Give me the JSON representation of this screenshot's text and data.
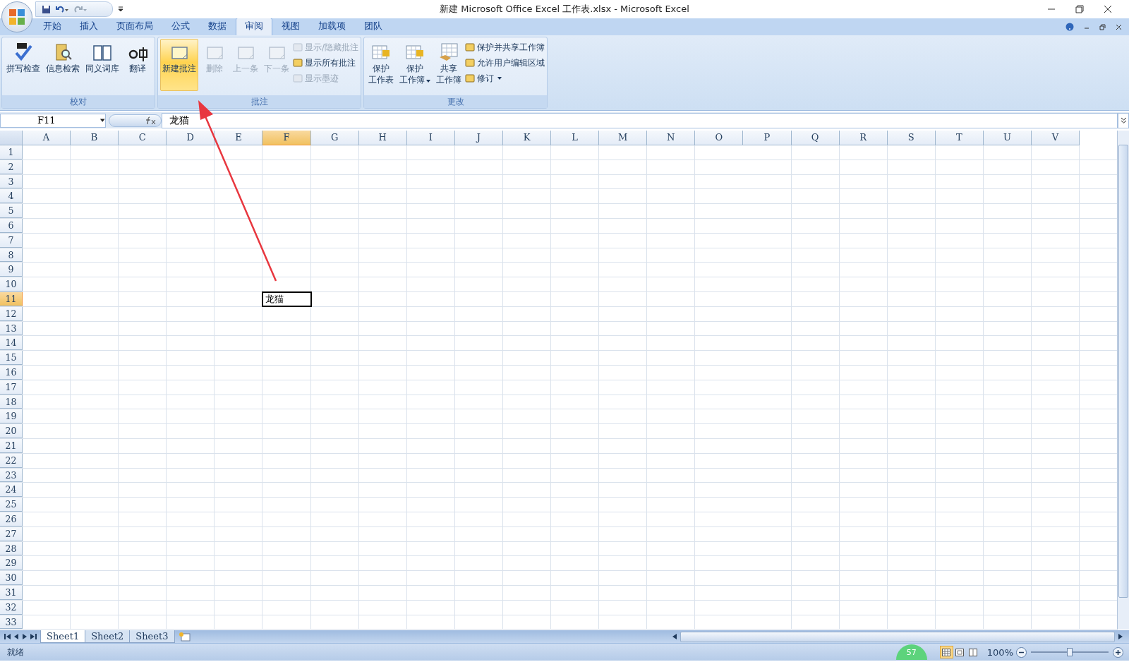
{
  "window": {
    "title": "新建 Microsoft Office Excel 工作表.xlsx - Microsoft Excel"
  },
  "tabs": [
    {
      "label": "开始",
      "selected": false
    },
    {
      "label": "插入",
      "selected": false
    },
    {
      "label": "页面布局",
      "selected": false
    },
    {
      "label": "公式",
      "selected": false
    },
    {
      "label": "数据",
      "selected": false
    },
    {
      "label": "审阅",
      "selected": true
    },
    {
      "label": "视图",
      "selected": false
    },
    {
      "label": "加载项",
      "selected": false
    },
    {
      "label": "团队",
      "selected": false
    }
  ],
  "ribbon": {
    "groups": [
      {
        "title": "校对",
        "buttons": [
          {
            "kind": "large",
            "lines": [
              "拼写检查"
            ],
            "disabled": false,
            "highlighted": false
          },
          {
            "kind": "large",
            "lines": [
              "信息检索"
            ],
            "disabled": false,
            "highlighted": false
          },
          {
            "kind": "large",
            "lines": [
              "同义词库"
            ],
            "disabled": false,
            "highlighted": false
          },
          {
            "kind": "large",
            "lines": [
              "翻译"
            ],
            "disabled": false,
            "highlighted": false
          }
        ]
      },
      {
        "title": "批注",
        "buttons": [
          {
            "kind": "large",
            "lines": [
              "新建批注"
            ],
            "disabled": false,
            "highlighted": true
          },
          {
            "kind": "large",
            "lines": [
              "删除"
            ],
            "disabled": true,
            "highlighted": false
          },
          {
            "kind": "large",
            "lines": [
              "上一条"
            ],
            "disabled": true,
            "highlighted": false
          },
          {
            "kind": "large",
            "lines": [
              "下一条"
            ],
            "disabled": true,
            "highlighted": false
          },
          {
            "kind": "small",
            "lines": [
              "显示/隐藏批注"
            ],
            "disabled": true
          },
          {
            "kind": "small",
            "lines": [
              "显示所有批注"
            ],
            "disabled": false
          },
          {
            "kind": "small",
            "lines": [
              "显示墨迹"
            ],
            "disabled": true
          }
        ]
      },
      {
        "title": "更改",
        "buttons": [
          {
            "kind": "large",
            "lines": [
              "保护",
              "工作表"
            ],
            "disabled": false,
            "highlighted": false
          },
          {
            "kind": "large",
            "lines": [
              "保护",
              "工作簿"
            ],
            "disabled": false,
            "highlighted": false,
            "dropdown": true
          },
          {
            "kind": "large",
            "lines": [
              "共享",
              "工作簿"
            ],
            "disabled": false,
            "highlighted": false
          },
          {
            "kind": "small",
            "lines": [
              "保护并共享工作簿"
            ],
            "disabled": false
          },
          {
            "kind": "small",
            "lines": [
              "允许用户编辑区域"
            ],
            "disabled": false
          },
          {
            "kind": "small",
            "lines": [
              "修订"
            ],
            "disabled": false,
            "dropdown": true
          }
        ]
      }
    ]
  },
  "formula_bar": {
    "name_box": "F11",
    "value": "龙猫"
  },
  "columns": [
    {
      "label": "A",
      "selected": false
    },
    {
      "label": "B",
      "selected": false
    },
    {
      "label": "C",
      "selected": false
    },
    {
      "label": "D",
      "selected": false
    },
    {
      "label": "E",
      "selected": false
    },
    {
      "label": "F",
      "selected": true
    },
    {
      "label": "G",
      "selected": false
    },
    {
      "label": "H",
      "selected": false
    },
    {
      "label": "I",
      "selected": false
    },
    {
      "label": "J",
      "selected": false
    },
    {
      "label": "K",
      "selected": false
    },
    {
      "label": "L",
      "selected": false
    },
    {
      "label": "M",
      "selected": false
    },
    {
      "label": "N",
      "selected": false
    },
    {
      "label": "O",
      "selected": false
    },
    {
      "label": "P",
      "selected": false
    },
    {
      "label": "Q",
      "selected": false
    },
    {
      "label": "R",
      "selected": false
    },
    {
      "label": "S",
      "selected": false
    },
    {
      "label": "T",
      "selected": false
    },
    {
      "label": "U",
      "selected": false
    },
    {
      "label": "V",
      "selected": false
    }
  ],
  "rows": [
    {
      "label": "1",
      "selected": false
    },
    {
      "label": "2",
      "selected": false
    },
    {
      "label": "3",
      "selected": false
    },
    {
      "label": "4",
      "selected": false
    },
    {
      "label": "5",
      "selected": false
    },
    {
      "label": "6",
      "selected": false
    },
    {
      "label": "7",
      "selected": false
    },
    {
      "label": "8",
      "selected": false
    },
    {
      "label": "9",
      "selected": false
    },
    {
      "label": "10",
      "selected": false
    },
    {
      "label": "11",
      "selected": true,
      "cells": [
        {
          "kind": "blank"
        },
        {
          "kind": "blank"
        },
        {
          "kind": "blank"
        },
        {
          "kind": "blank"
        },
        {
          "kind": "blank"
        },
        {
          "kind": "text",
          "text": "龙猫",
          "selected": true
        }
      ]
    },
    {
      "label": "12",
      "selected": false
    },
    {
      "label": "13",
      "selected": false
    },
    {
      "label": "14",
      "selected": false
    },
    {
      "label": "15",
      "selected": false
    },
    {
      "label": "16",
      "selected": false
    },
    {
      "label": "17",
      "selected": false
    },
    {
      "label": "18",
      "selected": false
    },
    {
      "label": "19",
      "selected": false
    },
    {
      "label": "20",
      "selected": false
    },
    {
      "label": "21",
      "selected": false
    },
    {
      "label": "22",
      "selected": false
    },
    {
      "label": "23",
      "selected": false
    },
    {
      "label": "24",
      "selected": false
    },
    {
      "label": "25",
      "selected": false
    },
    {
      "label": "26",
      "selected": false
    },
    {
      "label": "27",
      "selected": false
    },
    {
      "label": "28",
      "selected": false
    },
    {
      "label": "29",
      "selected": false
    },
    {
      "label": "30",
      "selected": false
    },
    {
      "label": "31",
      "selected": false
    },
    {
      "label": "32",
      "selected": false
    },
    {
      "label": "33",
      "selected": false
    }
  ],
  "sheets": [
    {
      "label": "Sheet1",
      "selected": true
    },
    {
      "label": "Sheet2",
      "selected": false
    },
    {
      "label": "Sheet3",
      "selected": false
    }
  ],
  "status_bar": {
    "text": "就绪",
    "badge": "57",
    "views": [
      {
        "selected": true
      },
      {
        "selected": false
      },
      {
        "selected": false
      }
    ],
    "zoom": "100%",
    "zoom_level": {
      "level": 0.5
    }
  }
}
